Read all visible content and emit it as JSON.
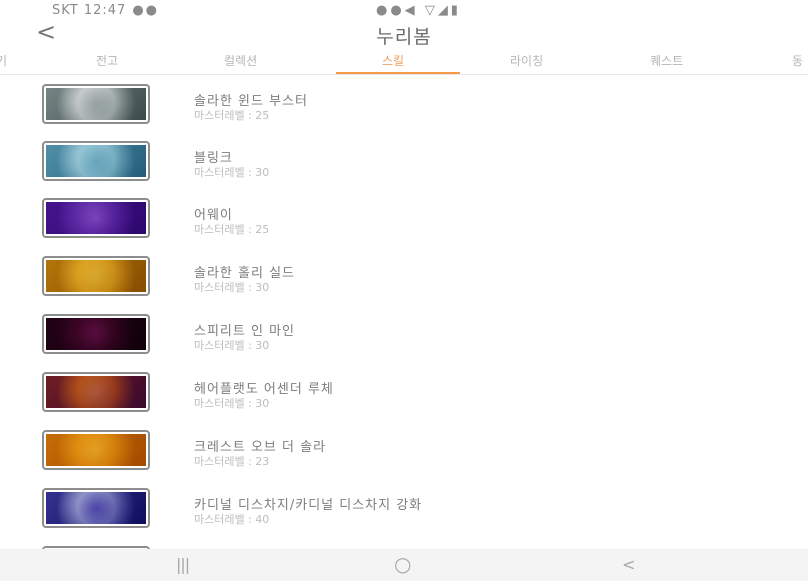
{
  "status_bar": {
    "left_text": "SKT 12:47",
    "left_dots": "●●",
    "right_text": "●●◀ ▽◢▮"
  },
  "header": {
    "back_glyph": "<",
    "title": "누리봄"
  },
  "tabs": [
    {
      "label": "기"
    },
    {
      "label": "전고"
    },
    {
      "label": "컬렉션"
    },
    {
      "label": "스킬"
    },
    {
      "label": "라이칭"
    },
    {
      "label": "퀘스트"
    },
    {
      "label": "동"
    }
  ],
  "active_tab": "스킬",
  "skills": [
    {
      "name": "솔라한 윈드 부스터",
      "level": "마스터레벨 : 25",
      "icon": "spellbook-icon",
      "colors": [
        "#f4f4f4",
        "#7b8a8a",
        "#cfd6d6"
      ]
    },
    {
      "name": "블링크",
      "level": "마스터레벨 : 30",
      "icon": "frost-waves-icon",
      "colors": [
        "#d7eef4",
        "#5f9ab0",
        "#a9d6e4"
      ]
    },
    {
      "name": "어웨이",
      "level": "마스터레벨 : 25",
      "icon": "violet-wings-icon",
      "colors": [
        "#a77ad8",
        "#6a2aa6",
        "#e4d2f6"
      ]
    },
    {
      "name": "솔라한 홀리 실드",
      "level": "마스터레벨 : 30",
      "icon": "golden-shield-icon",
      "colors": [
        "#f6d76a",
        "#b98b18",
        "#fff0b0"
      ]
    },
    {
      "name": "스피리트 인 마인",
      "level": "마스터레벨 : 30",
      "icon": "magenta-rune-icon",
      "colors": [
        "#8b2a6e",
        "#3f0b33",
        "#e07cc5"
      ]
    },
    {
      "name": "헤어플랫도 어센더 루체",
      "level": "마스터레벨 : 30",
      "icon": "flame-wave-icon",
      "colors": [
        "#e7a24d",
        "#7a2f6e",
        "#f5d9a0"
      ]
    },
    {
      "name": "크레스트 오브 더 솔라",
      "level": "마스터레벨 : 23",
      "icon": "sun-crest-icon",
      "colors": [
        "#f6c94c",
        "#cc8a12",
        "#fff0b8"
      ]
    },
    {
      "name": "카디널 디스차지/카디널 디스차지 강화",
      "level": "마스터레벨 : 40",
      "icon": "arrow-burst-icon",
      "colors": [
        "#d8dcef",
        "#3f3a9a",
        "#8d7fd8"
      ]
    }
  ],
  "nav_bar": {
    "recent_glyph": "|||",
    "home_glyph": "○",
    "back_glyph": "<"
  }
}
